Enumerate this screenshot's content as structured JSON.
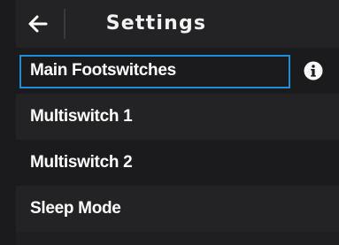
{
  "header": {
    "title": "Settings",
    "back_icon": "arrow-left-icon"
  },
  "menu": {
    "items": [
      {
        "label": "Main Footswitches",
        "selected": true,
        "info_icon": "info-icon"
      },
      {
        "label": "Multiswitch 1",
        "selected": false
      },
      {
        "label": "Multiswitch 2",
        "selected": false
      },
      {
        "label": "Sleep Mode",
        "selected": false
      }
    ]
  },
  "colors": {
    "background": "#1b1b1d",
    "header_background": "#232325",
    "alt_row_background": "#232325",
    "focus_outline": "#1e8fd6",
    "text": "#ffffff"
  }
}
